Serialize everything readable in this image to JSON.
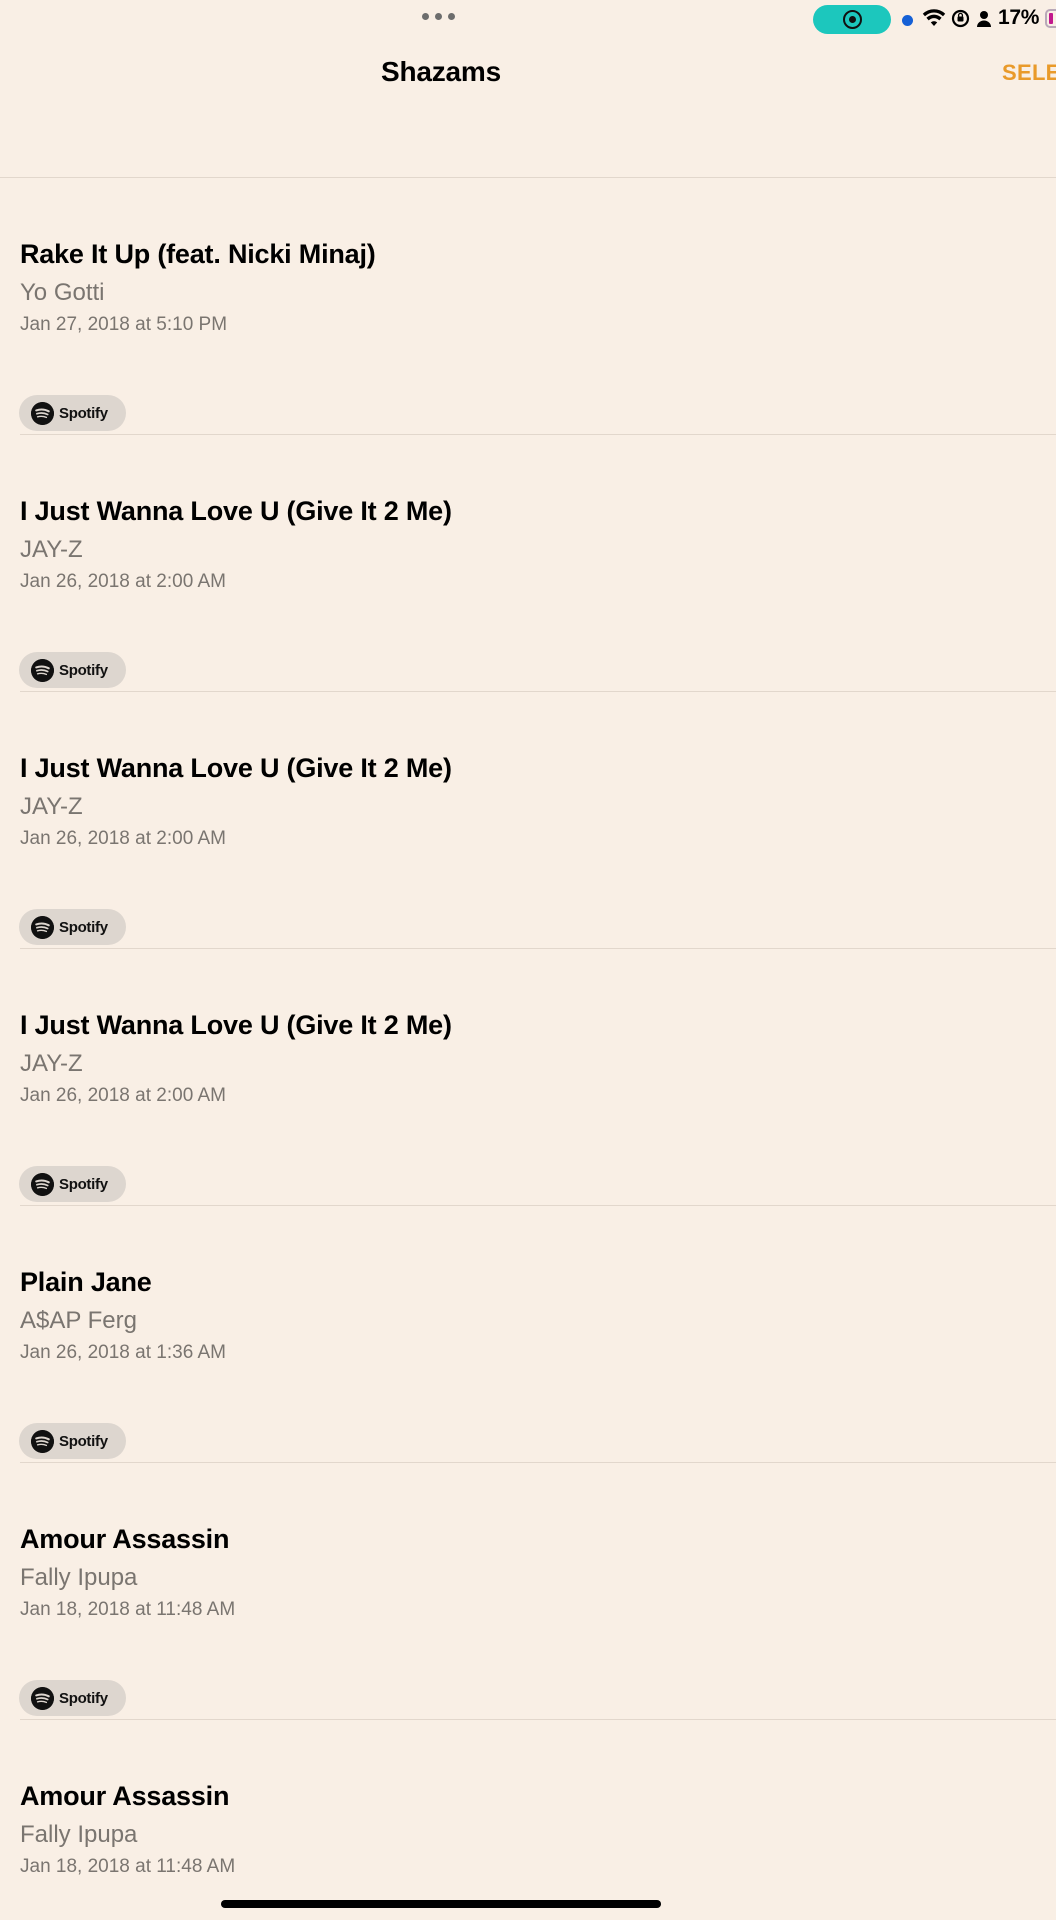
{
  "status_bar": {
    "battery_percent": "17%"
  },
  "nav": {
    "title": "Shazams",
    "select_label": "SELE"
  },
  "list": {
    "items": [
      {
        "title": "Rake It Up (feat. Nicki Minaj)",
        "artist": "Yo Gotti",
        "time": "Jan 27, 2018 at 5:10 PM",
        "badge": "Spotify"
      },
      {
        "title": "I Just Wanna Love U (Give It 2 Me)",
        "artist": "JAY-Z",
        "time": "Jan 26, 2018 at 2:00 AM",
        "badge": "Spotify"
      },
      {
        "title": "I Just Wanna Love U (Give It 2 Me)",
        "artist": "JAY-Z",
        "time": "Jan 26, 2018 at 2:00 AM",
        "badge": "Spotify"
      },
      {
        "title": "I Just Wanna Love U (Give It 2 Me)",
        "artist": "JAY-Z",
        "time": "Jan 26, 2018 at 2:00 AM",
        "badge": "Spotify"
      },
      {
        "title": "Plain Jane",
        "artist": "A$AP Ferg",
        "time": "Jan 26, 2018 at 1:36 AM",
        "badge": "Spotify"
      },
      {
        "title": "Amour Assassin",
        "artist": "Fally Ipupa",
        "time": "Jan 18, 2018 at 11:48 AM",
        "badge": "Spotify"
      },
      {
        "title": "Amour Assassin",
        "artist": "Fally Ipupa",
        "time": "Jan 18, 2018 at 11:48 AM",
        "badge": "Spotify"
      }
    ]
  },
  "colors": {
    "background": "#f9efe5",
    "accent": "#e99a2a",
    "secondary_text": "#7a7570",
    "recording_pill": "#1cc7bd"
  }
}
